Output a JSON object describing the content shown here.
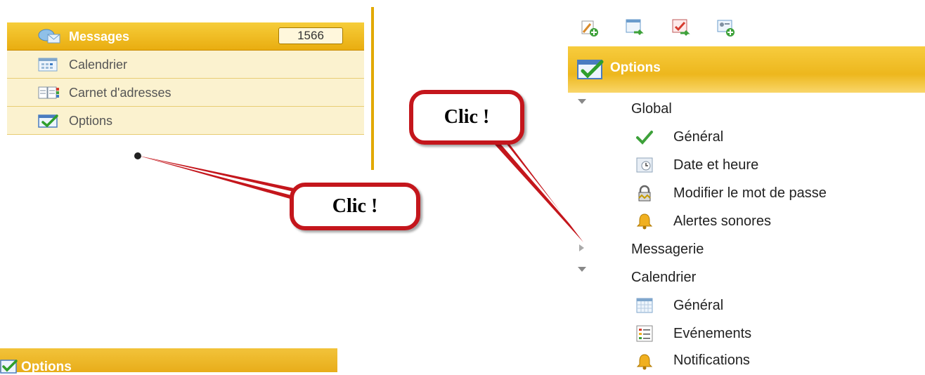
{
  "nav": {
    "items": [
      {
        "label": "Messages",
        "badge": "1566",
        "icon": "messages-icon",
        "active": true
      },
      {
        "label": "Calendrier",
        "icon": "calendar-icon"
      },
      {
        "label": "Carnet d'adresses",
        "icon": "address-book-icon"
      },
      {
        "label": "Options",
        "icon": "options-icon"
      }
    ]
  },
  "callouts": {
    "left": "Clic !",
    "right": "Clic !",
    "color": "#c4161c"
  },
  "toolbar": {
    "icons": [
      "add-user-icon",
      "export-icon",
      "import-icon",
      "add-contact-icon"
    ]
  },
  "options_panel": {
    "header": "Options",
    "sections": [
      {
        "label": "Global",
        "expanded": true,
        "items": [
          {
            "label": "Général",
            "icon": "check-icon"
          },
          {
            "label": "Date et heure",
            "icon": "clock-icon"
          },
          {
            "label": "Modifier le mot de passe",
            "icon": "lock-icon"
          },
          {
            "label": "Alertes sonores",
            "icon": "bell-icon"
          }
        ]
      },
      {
        "label": "Messagerie",
        "expanded": false,
        "items": []
      },
      {
        "label": "Calendrier",
        "expanded": true,
        "items": [
          {
            "label": "Général",
            "icon": "calendar-grid-icon"
          },
          {
            "label": "Evénements",
            "icon": "event-list-icon"
          },
          {
            "label": "Notifications",
            "icon": "bell-icon"
          }
        ]
      }
    ]
  },
  "bottom_header": {
    "label": "Options"
  },
  "colors": {
    "accent": "#f0bb22",
    "panel_bg": "#fbf2cf",
    "callout_border": "#c4161c"
  }
}
